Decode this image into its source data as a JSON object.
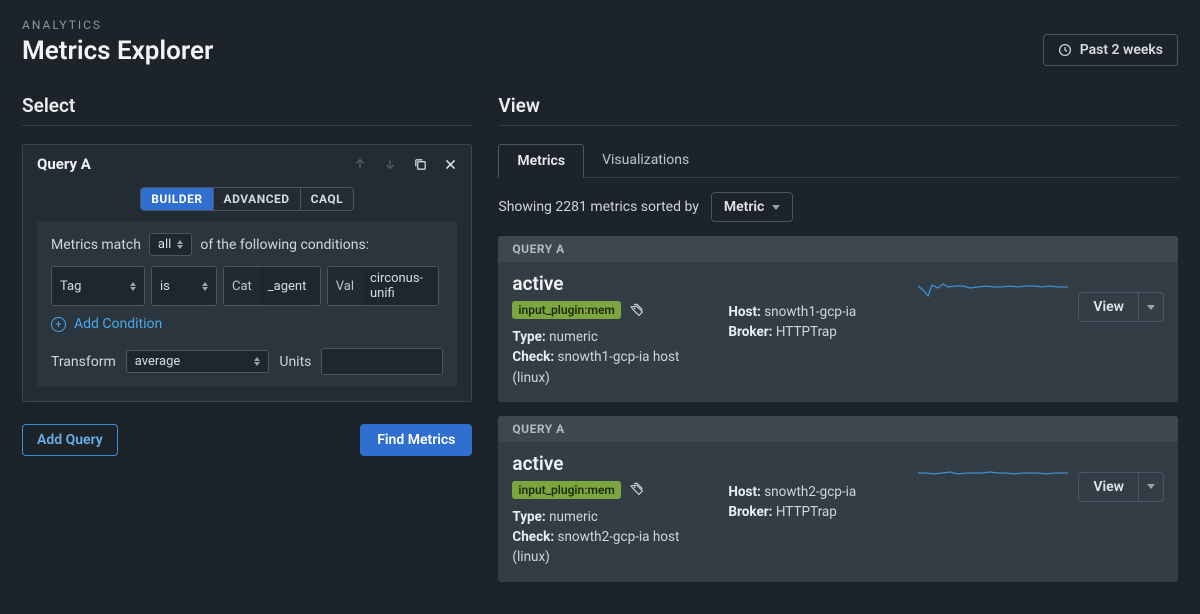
{
  "header": {
    "eyebrow": "ANALYTICS",
    "title": "Metrics Explorer",
    "timerange_label": "Past 2 weeks"
  },
  "select": {
    "title": "Select",
    "query_label": "Query A",
    "modes": {
      "builder": "BUILDER",
      "advanced": "ADVANCED",
      "caql": "CAQL"
    },
    "match_pre": "Metrics match",
    "match_scope": "all",
    "match_post": "of the following conditions:",
    "cond": {
      "field1": "Tag",
      "op": "is",
      "cat_label": "Cat",
      "cat_value": "_agent",
      "val_label": "Val",
      "val_value": "circonus-unifi"
    },
    "add_condition_label": "Add Condition",
    "transform_label": "Transform",
    "transform_value": "average",
    "units_label": "Units",
    "add_query_label": "Add Query",
    "find_metrics_label": "Find Metrics"
  },
  "view": {
    "title": "View",
    "tabs": {
      "metrics": "Metrics",
      "vis": "Visualizations"
    },
    "showing_pre": "Showing ",
    "showing_count": "2281",
    "showing_post": " metrics sorted by",
    "sort_label": "Metric",
    "results": [
      {
        "strip": "QUERY A",
        "name": "active",
        "tag": "input_plugin:mem",
        "type_label": "Type:",
        "type_value": "numeric",
        "check_label": "Check:",
        "check_value": "snowth1-gcp-ia host (linux)",
        "host_label": "Host:",
        "host_value": "snowth1-gcp-ia",
        "broker_label": "Broker:",
        "broker_value": "HTTPTrap",
        "view_label": "View"
      },
      {
        "strip": "QUERY A",
        "name": "active",
        "tag": "input_plugin:mem",
        "type_label": "Type:",
        "type_value": "numeric",
        "check_label": "Check:",
        "check_value": "snowth2-gcp-ia host (linux)",
        "host_label": "Host:",
        "host_value": "snowth2-gcp-ia",
        "broker_label": "Broker:",
        "broker_value": "HTTPTrap",
        "view_label": "View"
      }
    ]
  },
  "chart_data": [
    {
      "type": "line",
      "title": "",
      "xlabel": "",
      "ylabel": "",
      "series": [
        {
          "name": "active (snowth1-gcp-ia)",
          "values": [
            22,
            18,
            12,
            23,
            20,
            24,
            21,
            22,
            22,
            20,
            21,
            22,
            21,
            21,
            22,
            21,
            22,
            23,
            22,
            21,
            22,
            21,
            22,
            22,
            21,
            22,
            22,
            21,
            22,
            22
          ]
        }
      ],
      "ylim": [
        0,
        30
      ]
    },
    {
      "type": "line",
      "title": "",
      "xlabel": "",
      "ylabel": "",
      "series": [
        {
          "name": "active (snowth2-gcp-ia)",
          "values": [
            15,
            15,
            14,
            15,
            16,
            14,
            15,
            15,
            15,
            16,
            15,
            15,
            14,
            15,
            15,
            15,
            16,
            15,
            15,
            15,
            15,
            14,
            15,
            15,
            16,
            15,
            15,
            15,
            15,
            15
          ]
        }
      ],
      "ylim": [
        0,
        30
      ]
    }
  ]
}
